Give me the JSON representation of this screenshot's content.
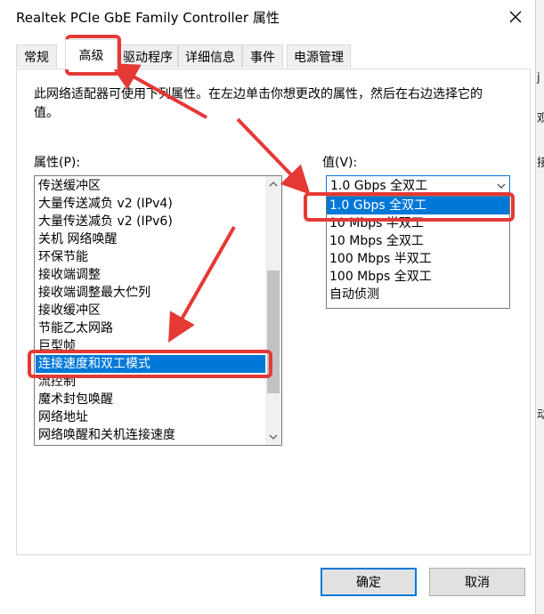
{
  "dialog": {
    "title": "Realtek PCIe GbE Family Controller 属性"
  },
  "tabs": [
    {
      "label": "常规"
    },
    {
      "label": "高级"
    },
    {
      "label": "驱动程序"
    },
    {
      "label": "详细信息"
    },
    {
      "label": "事件"
    },
    {
      "label": "电源管理"
    }
  ],
  "advanced": {
    "description": "此网络适配器可使用下列属性。在左边单击你想更改的属性，然后在右边选择它的值。",
    "property_label": "属性(P):",
    "value_label": "值(V):",
    "properties": [
      "传送缓冲区",
      "大量传送减负 v2 (IPv4)",
      "大量传送减负 v2 (IPv6)",
      "关机 网络唤醒",
      "环保节能",
      "接收端调整",
      "接收端调整最大伫列",
      "接收缓冲区",
      "节能乙太网路",
      "巨型帧",
      "连接速度和双工模式",
      "流控制",
      "魔术封包唤醒",
      "网络地址",
      "网络唤醒和关机连接速度"
    ],
    "selected_property": "连接速度和双工模式",
    "combo_value": "1.0 Gbps 全双工",
    "value_options": [
      "1.0 Gbps 全双工",
      "10 Mbps 半双工",
      "10 Mbps 全双工",
      "100 Mbps 半双工",
      "100 Mbps 全双工",
      "自动侦测"
    ],
    "selected_value": "1.0 Gbps 全双工"
  },
  "buttons": {
    "ok": "确定",
    "cancel": "取消"
  },
  "background_fragments": {
    "left_top": "et",
    "left_bottom": "量",
    "right_1": "j",
    "right_2": "观",
    "right_3": "接",
    "right_4": "动"
  },
  "colors": {
    "selection": "#0078d7",
    "annotation": "#e53935"
  }
}
